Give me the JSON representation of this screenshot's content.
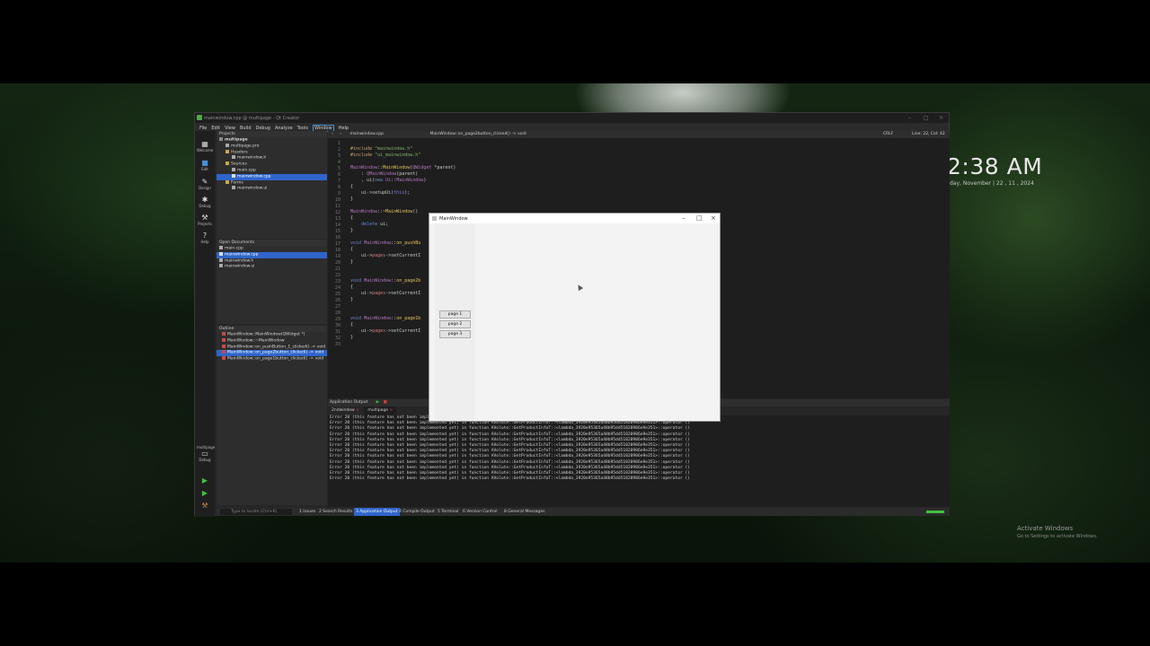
{
  "desktop": {
    "clock": "2:38 AM",
    "date": "day, November | 22 , 11 , 2024",
    "activate_title": "Activate Windows",
    "activate_sub": "Go to Settings to activate Windows."
  },
  "qtc": {
    "title": "mainwindow.cpp @ multipage - Qt Creator",
    "menu": [
      "File",
      "Edit",
      "View",
      "Build",
      "Debug",
      "Analyze",
      "Tools",
      "Window",
      "Help"
    ],
    "modes": [
      {
        "label": "Welcome",
        "icon": "grid-icon"
      },
      {
        "label": "Edit",
        "icon": "edit-icon"
      },
      {
        "label": "Design",
        "icon": "pencil-icon"
      },
      {
        "label": "Debug",
        "icon": "bug-icon"
      },
      {
        "label": "Projects",
        "icon": "wrench-icon"
      },
      {
        "label": "Help",
        "icon": "help-icon"
      }
    ],
    "kit_label": "multipage",
    "kit_mode": "Debug",
    "projects_header": "Projects",
    "project_tree": [
      {
        "label": "multipage",
        "indent": 0,
        "selected": false
      },
      {
        "label": "multipage.pro",
        "indent": 1,
        "selected": false
      },
      {
        "label": "Headers",
        "indent": 1,
        "selected": false
      },
      {
        "label": "mainwindow.h",
        "indent": 2,
        "selected": false
      },
      {
        "label": "Sources",
        "indent": 1,
        "selected": false
      },
      {
        "label": "main.cpp",
        "indent": 2,
        "selected": false
      },
      {
        "label": "mainwindow.cpp",
        "indent": 2,
        "selected": true
      },
      {
        "label": "Forms",
        "indent": 1,
        "selected": false
      },
      {
        "label": "mainwindow.ui",
        "indent": 2,
        "selected": false
      }
    ],
    "open_docs_header": "Open Documents",
    "open_docs": [
      {
        "label": "main.cpp",
        "selected": false
      },
      {
        "label": "mainwindow.cpp",
        "selected": true
      },
      {
        "label": "mainwindow.h",
        "selected": false
      },
      {
        "label": "mainwindow.ui",
        "selected": false
      }
    ],
    "outline_header": "Outline",
    "outline": [
      {
        "label": "MainWindow::MainWindow(QWidget *)",
        "selected": false
      },
      {
        "label": "MainWindow::~MainWindow",
        "selected": false
      },
      {
        "label": "MainWindow::on_pushButton_1_clicked() -> void",
        "selected": false
      },
      {
        "label": "MainWindow::on_page2button_clicked() -> void",
        "selected": true
      },
      {
        "label": "MainWindow::on_page1button_clicked() -> void",
        "selected": false
      }
    ],
    "editor_file": "mainwindow.cpp",
    "editor_symbol": "MainWindow::on_page2button_clicked() -> void",
    "editor_encoding": "CRLF",
    "editor_position": "Line: 22, Col: 42",
    "output_header": "Application Output",
    "output_tabs": [
      "2ndwindow",
      "multipage"
    ],
    "output_lines": [
      "Error 20 (this feature has not been implemented yet) in function AVolute::GetProductInfoT::<lambda_3920e95365a48b95dd51820986e9e351>::operator ()",
      "Error 20 (this feature has not been implemented yet) in function AVolute::GetProductInfoT::<lambda_3920e95365a48b95dd51820986e9e351>::operator ()",
      "Error 20 (this feature has not been implemented yet) in function AVolute::GetProductInfoT::<lambda_3920e95365a48b95dd51820986e9e351>::operator ()",
      "Error 20 (this feature has not been implemented yet) in function AVolute::GetProductInfoT::<lambda_3920e95365a48b95dd51820986e9e351>::operator ()",
      "Error 20 (this feature has not been implemented yet) in function AVolute::GetProductInfoT::<lambda_3920e95365a48b95dd51820986e9e351>::operator ()",
      "Error 20 (this feature has not been implemented yet) in function AVolute::GetProductInfoT::<lambda_3920e95365a48b95dd51820986e9e351>::operator ()",
      "Error 20 (this feature has not been implemented yet) in function AVolute::GetProductInfoT::<lambda_3920e95365a48b95dd51820986e9e351>::operator ()",
      "Error 20 (this feature has not been implemented yet) in function AVolute::GetProductInfoT::<lambda_3920e95365a48b95dd51820986e9e351>::operator ()",
      "Error 20 (this feature has not been implemented yet) in function AVolute::GetProductInfoT::<lambda_3920e95365a48b95dd51820986e9e351>::operator ()",
      "Error 20 (this feature has not been implemented yet) in function AVolute::GetProductInfoT::<lambda_3920e95365a48b95dd51820986e9e351>::operator ()",
      "Error 20 (this feature has not been implemented yet) in function AVolute::GetProductInfoT::<lambda_3920e95365a48b95dd51820986e9e351>::operator ()",
      "Error 20 (this feature has not been implemented yet) in function AVolute::GetProductInfoT::<lambda_3920e95365a48b95dd51820986e9e351>::operator ()"
    ],
    "locator_placeholder": "Type to locate (Ctrl+K)",
    "status_tabs": [
      "1 Issues",
      "2 Search Results",
      "3 Application Output",
      "4 Compile Output",
      "5 Terminal",
      "6 Version Control",
      "8 General Messages"
    ],
    "status_active_tab": "3 Application Output",
    "build_progress": 1.0
  },
  "mainwindow": {
    "title": "MainWindow",
    "buttons": [
      "page 1",
      "page 2",
      "page 3"
    ]
  }
}
